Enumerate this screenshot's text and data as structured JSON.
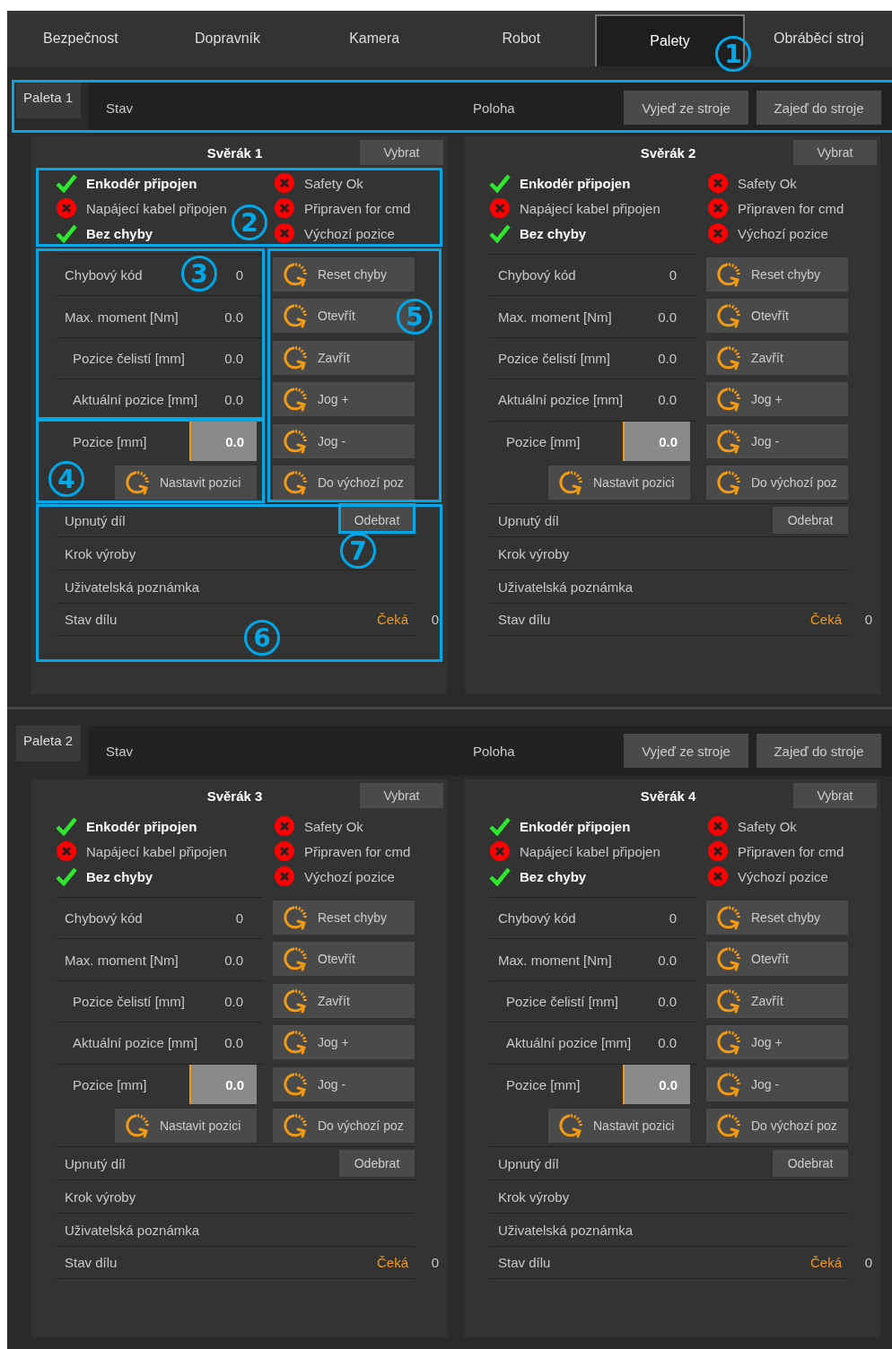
{
  "tabs": [
    {
      "label": "Bezpečnost",
      "selected": false
    },
    {
      "label": "Dopravník",
      "selected": false
    },
    {
      "label": "Kamera",
      "selected": false
    },
    {
      "label": "Robot",
      "selected": false
    },
    {
      "label": "Palety",
      "selected": true
    },
    {
      "label": "Obráběcí stroj",
      "selected": false
    }
  ],
  "pallets": [
    {
      "label": "Paleta 1",
      "status_label": "Stav",
      "position_label": "Poloha",
      "buttons": [
        "Vyjeď ze stroje",
        "Zajeď do stroje"
      ],
      "vises": [
        {
          "title": "Svěrák 1",
          "select_button": "Vybrat",
          "indicators": [
            {
              "label": "Enkodér připojen",
              "ok": true
            },
            {
              "label": "Napájecí kabel připojen",
              "ok": false
            },
            {
              "label": "Bez chyby",
              "ok": true
            },
            {
              "label": "Safety Ok",
              "ok": false
            },
            {
              "label": "Připraven for cmd",
              "ok": false
            },
            {
              "label": "Výchozí pozice",
              "ok": false
            }
          ],
          "readouts": [
            {
              "label": "Chybový kód",
              "value": "0",
              "indent": false
            },
            {
              "label": "Max. moment [Nm]",
              "value": "0.0",
              "indent": false
            },
            {
              "label": "Pozice čelistí [mm]",
              "value": "0.0",
              "indent": true
            },
            {
              "label": "Aktuální pozice [mm]",
              "value": "0.0",
              "indent": true
            }
          ],
          "position_input": {
            "label": "Pozice [mm]",
            "value": "0.0"
          },
          "set_button": "Nastavit pozici",
          "actions": [
            "Reset chyby",
            "Otevřít",
            "Zavřít",
            "Jog +",
            "Jog -",
            "Do výchozí poz"
          ],
          "part_rows": [
            {
              "label": "Upnutý díl",
              "button": "Odebrat"
            },
            {
              "label": "Krok výroby"
            },
            {
              "label": "Uživatelská poznámka"
            },
            {
              "label": "Stav dílu",
              "status": "Čeká",
              "count": "0"
            }
          ]
        },
        {
          "title": "Svěrák 2",
          "select_button": "Vybrat",
          "indicators": [
            {
              "label": "Enkodér připojen",
              "ok": true
            },
            {
              "label": "Napájecí kabel připojen",
              "ok": false
            },
            {
              "label": "Bez chyby",
              "ok": true
            },
            {
              "label": "Safety Ok",
              "ok": false
            },
            {
              "label": "Připraven for cmd",
              "ok": false
            },
            {
              "label": "Výchozí pozice",
              "ok": false
            }
          ],
          "readouts": [
            {
              "label": "Chybový kód",
              "value": "0",
              "indent": false
            },
            {
              "label": "Max. moment [Nm]",
              "value": "0.0",
              "indent": false
            },
            {
              "label": "Pozice čelistí [mm]",
              "value": "0.0",
              "indent": false
            },
            {
              "label": "Aktuální pozice [mm]",
              "value": "0.0",
              "indent": false
            }
          ],
          "position_input": {
            "label": "Pozice [mm]",
            "value": "0.0"
          },
          "set_button": "Nastavit pozici",
          "actions": [
            "Reset chyby",
            "Otevřít",
            "Zavřít",
            "Jog +",
            "Jog -",
            "Do výchozí poz"
          ],
          "part_rows": [
            {
              "label": "Upnutý díl",
              "button": "Odebrat"
            },
            {
              "label": "Krok výroby"
            },
            {
              "label": "Uživatelská poznámka"
            },
            {
              "label": "Stav dílu",
              "status": "Čeká",
              "count": "0"
            }
          ]
        }
      ]
    },
    {
      "label": "Paleta 2",
      "status_label": "Stav",
      "position_label": "Poloha",
      "buttons": [
        "Vyjeď ze stroje",
        "Zajeď do stroje"
      ],
      "vises": [
        {
          "title": "Svěrák 3",
          "select_button": "Vybrat",
          "indicators": [
            {
              "label": "Enkodér připojen",
              "ok": true
            },
            {
              "label": "Napájecí kabel připojen",
              "ok": false
            },
            {
              "label": "Bez chyby",
              "ok": true
            },
            {
              "label": "Safety Ok",
              "ok": false
            },
            {
              "label": "Připraven for cmd",
              "ok": false
            },
            {
              "label": "Výchozí pozice",
              "ok": false
            }
          ],
          "readouts": [
            {
              "label": "Chybový kód",
              "value": "0",
              "indent": false
            },
            {
              "label": "Max. moment [Nm]",
              "value": "0.0",
              "indent": false
            },
            {
              "label": "Pozice čelistí [mm]",
              "value": "0.0",
              "indent": true
            },
            {
              "label": "Aktuální pozice [mm]",
              "value": "0.0",
              "indent": true
            }
          ],
          "position_input": {
            "label": "Pozice [mm]",
            "value": "0.0"
          },
          "set_button": "Nastavit pozici",
          "actions": [
            "Reset chyby",
            "Otevřít",
            "Zavřít",
            "Jog +",
            "Jog -",
            "Do výchozí poz"
          ],
          "part_rows": [
            {
              "label": "Upnutý díl",
              "button": "Odebrat"
            },
            {
              "label": "Krok výroby"
            },
            {
              "label": "Uživatelská poznámka"
            },
            {
              "label": "Stav dílu",
              "status": "Čeká",
              "count": "0"
            }
          ]
        },
        {
          "title": "Svěrák 4",
          "select_button": "Vybrat",
          "indicators": [
            {
              "label": "Enkodér připojen",
              "ok": true
            },
            {
              "label": "Napájecí kabel připojen",
              "ok": false
            },
            {
              "label": "Bez chyby",
              "ok": true
            },
            {
              "label": "Safety Ok",
              "ok": false
            },
            {
              "label": "Připraven for cmd",
              "ok": false
            },
            {
              "label": "Výchozí pozice",
              "ok": false
            }
          ],
          "readouts": [
            {
              "label": "Chybový kód",
              "value": "0",
              "indent": false
            },
            {
              "label": "Max. moment [Nm]",
              "value": "0.0",
              "indent": false
            },
            {
              "label": "Pozice čelistí [mm]",
              "value": "0.0",
              "indent": true
            },
            {
              "label": "Aktuální pozice [mm]",
              "value": "0.0",
              "indent": true
            }
          ],
          "position_input": {
            "label": "Pozice [mm]",
            "value": "0.0"
          },
          "set_button": "Nastavit pozici",
          "actions": [
            "Reset chyby",
            "Otevřít",
            "Zavřít",
            "Jog +",
            "Jog -",
            "Do výchozí poz"
          ],
          "part_rows": [
            {
              "label": "Upnutý díl",
              "button": "Odebrat"
            },
            {
              "label": "Krok výroby"
            },
            {
              "label": "Uživatelská poznámka"
            },
            {
              "label": "Stav dílu",
              "status": "Čeká",
              "count": "0"
            }
          ]
        }
      ]
    }
  ],
  "annotations": {
    "callouts": [
      "1",
      "2",
      "3",
      "4",
      "5",
      "6",
      "7"
    ]
  }
}
